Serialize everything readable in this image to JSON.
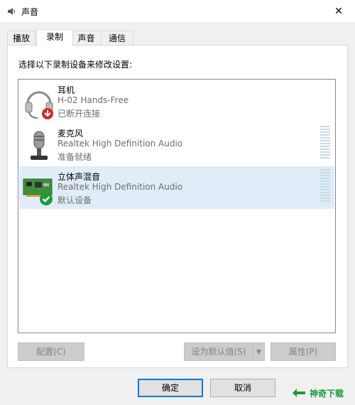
{
  "window": {
    "title": "声音",
    "close_glyph": "✕"
  },
  "tabs": [
    {
      "label": "播放"
    },
    {
      "label": "录制",
      "active": true
    },
    {
      "label": "声音"
    },
    {
      "label": "通信"
    }
  ],
  "instruction": "选择以下录制设备来修改设置:",
  "devices": [
    {
      "name": "耳机",
      "description": "H-02 Hands-Free",
      "status": "已断开连接",
      "icon": "headset-icon",
      "badge": "disconnected-arrow-icon"
    },
    {
      "name": "麦克风",
      "description": "Realtek High Definition Audio",
      "status": "准备就绪",
      "icon": "microphone-icon"
    },
    {
      "name": "立体声混音",
      "description": "Realtek High Definition Audio",
      "status": "默认设备",
      "icon": "sound-card-icon",
      "badge": "default-check-icon",
      "selected": true
    }
  ],
  "buttons": {
    "configure": "配置(C)",
    "set_default": "设为默认值(S)",
    "properties": "属性(P)",
    "ok": "确定",
    "cancel": "取消"
  },
  "watermark": {
    "text": "神奇下载"
  },
  "colors": {
    "selection": "#e0edf8",
    "accent": "#0078d7",
    "meter": "#c5dbe6",
    "ok_badge": "#1e9a3b",
    "warn_badge": "#d42a2a"
  }
}
